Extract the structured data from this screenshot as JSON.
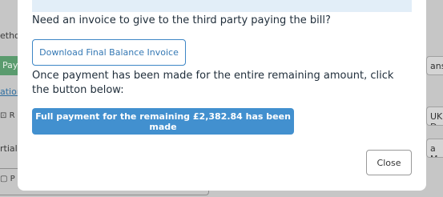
{
  "background": {
    "frag_method": "etho",
    "frag_pay": "Pay",
    "frag_link": "ation",
    "frag_r": "R",
    "frag_partial": "rtial",
    "frag_p": "P",
    "frag_right_1": "ansf",
    "frag_right_2": "UK D",
    "frag_right_3": "a My"
  },
  "modal": {
    "question": "Need an invoice to give to the third party paying the bill?",
    "download_button": "Download Final Balance Invoice",
    "instruction": "Once payment has been made for the entire remaining amount, click the button below:",
    "full_payment_button": "Full payment for the remaining £2,382.84 has been made",
    "close_button": "Close"
  }
}
